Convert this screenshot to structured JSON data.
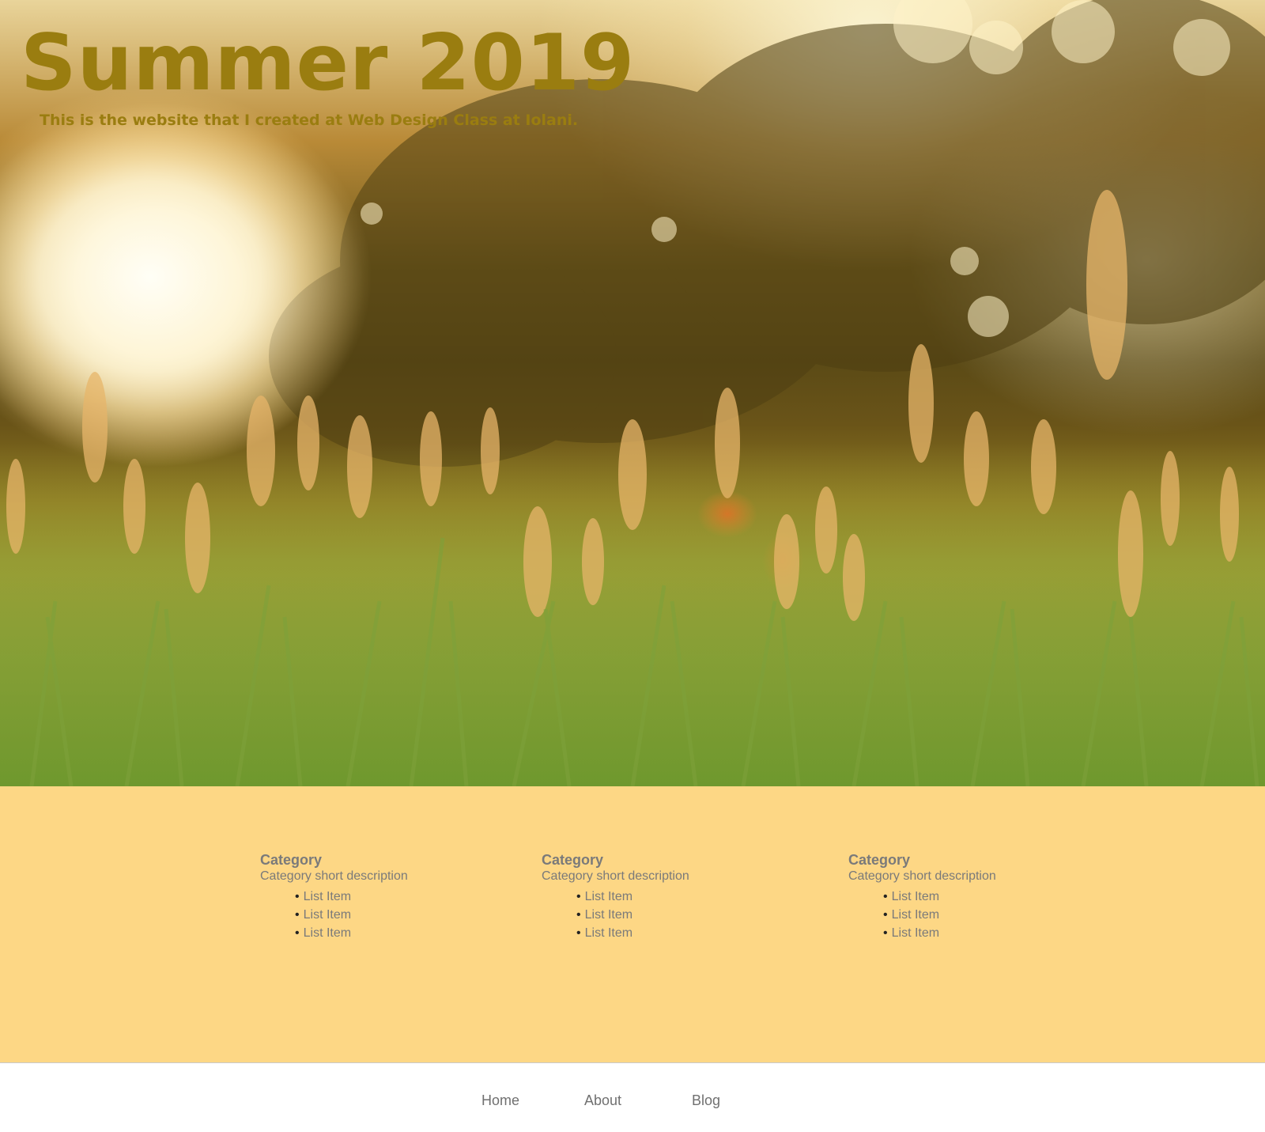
{
  "hero": {
    "title": "Summer 2019",
    "subtitle": "This is the website that I created at Web Design Class at Iolani.",
    "title_color": "#9a7d10",
    "background_image": "sunlit-tall-grass-field-photo"
  },
  "categories": {
    "background_color": "#fdd785",
    "items": [
      {
        "title": "Category",
        "description": "Category short description",
        "list": [
          "List Item",
          "List Item",
          "List Item"
        ]
      },
      {
        "title": "Category",
        "description": "Category short description",
        "list": [
          "List Item",
          "List Item",
          "List Item"
        ]
      },
      {
        "title": "Category",
        "description": "Category short description",
        "list": [
          "List Item",
          "List Item",
          "List Item"
        ]
      }
    ]
  },
  "footer": {
    "nav": [
      {
        "label": "Home"
      },
      {
        "label": "About"
      },
      {
        "label": "Blog"
      }
    ]
  },
  "bullet": "•"
}
